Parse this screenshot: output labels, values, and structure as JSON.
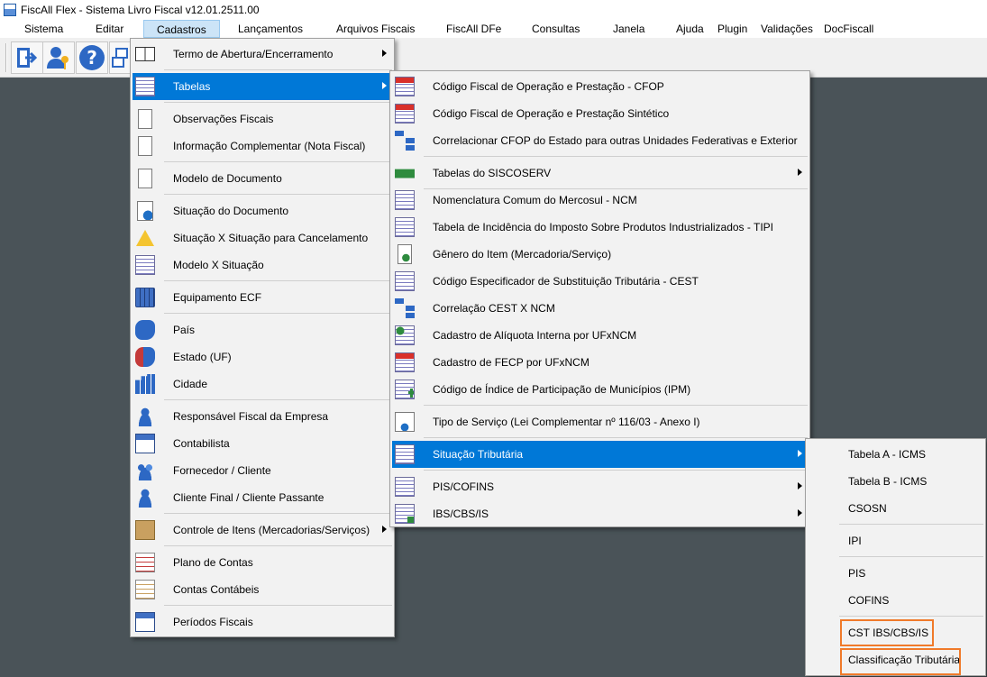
{
  "window": {
    "title": "FiscAll Flex - Sistema Livro Fiscal v12.01.2511.00"
  },
  "menubar": {
    "items": [
      "Sistema",
      "Editar",
      "Cadastros",
      "Lançamentos",
      "Arquivos Fiscais",
      "FiscAll DFe",
      "Consultas",
      "Janela",
      "Ajuda",
      "Plugin",
      "Validações",
      "DocFiscall"
    ],
    "active": "Cadastros"
  },
  "toolbar": {
    "icons": [
      "exit-icon",
      "user-key-icon",
      "help-icon",
      "window-icon"
    ]
  },
  "cadastros_menu": {
    "items": [
      {
        "label": "Termo de Abertura/Encerramento",
        "icon": "book-icon",
        "submenu": true
      },
      {
        "label": "Tabelas",
        "icon": "table-icon",
        "submenu": true,
        "highlighted": true
      },
      {
        "label": "Observações Fiscais",
        "icon": "document-pen-icon"
      },
      {
        "label": "Informação Complementar (Nota Fiscal)",
        "icon": "document-add-icon"
      },
      {
        "label": "Modelo de Documento",
        "icon": "document-icon"
      },
      {
        "label": "Situação do Documento",
        "icon": "document-info-icon"
      },
      {
        "label": "Situação X Situação para Cancelamento",
        "icon": "warning-icon"
      },
      {
        "label": "Modelo X Situação",
        "icon": "table-icon"
      },
      {
        "label": "Equipamento ECF",
        "icon": "calculator-icon"
      },
      {
        "label": "País",
        "icon": "map-icon"
      },
      {
        "label": "Estado (UF)",
        "icon": "map-state-icon"
      },
      {
        "label": "Cidade",
        "icon": "city-icon"
      },
      {
        "label": "Responsável Fiscal da Empresa",
        "icon": "user-icon"
      },
      {
        "label": "Contabilista",
        "icon": "accountant-icon"
      },
      {
        "label": "Fornecedor / Cliente",
        "icon": "users-icon"
      },
      {
        "label": "Cliente Final / Cliente Passante",
        "icon": "user-icon"
      },
      {
        "label": "Controle de Itens (Mercadorias/Serviços)",
        "icon": "box-icon",
        "submenu": true
      },
      {
        "label": "Plano de Contas",
        "icon": "sheet-icon"
      },
      {
        "label": "Contas Contábeis",
        "icon": "ledger-icon"
      },
      {
        "label": "Períodos Fiscais",
        "icon": "calendar-icon"
      }
    ]
  },
  "tabelas_menu": {
    "items": [
      {
        "label": "Código Fiscal de Operação e Prestação - CFOP",
        "icon": "table-cfop-icon"
      },
      {
        "label": "Código Fiscal de Operação e Prestação Sintético",
        "icon": "table-red-icon"
      },
      {
        "label": "Correlacionar CFOP do Estado para outras Unidades Federativas e Exterior",
        "icon": "tree-icon"
      },
      {
        "label": "Tabelas do SISCOSERV",
        "icon": "brazil-flag-icon",
        "submenu": true
      },
      {
        "label": "Nomenclatura Comum do Mercosul  - NCM",
        "icon": "table-ncm-icon"
      },
      {
        "label": "Tabela de Incidência do Imposto Sobre Produtos Industrializados - TIPI",
        "icon": "table-tipi-icon"
      },
      {
        "label": "Gênero do Item (Mercadoria/Serviço)",
        "icon": "money-icon"
      },
      {
        "label": "Código Especificador de Substituição Tributária - CEST",
        "icon": "table-cest-icon"
      },
      {
        "label": "Correlação CEST X NCM",
        "icon": "tree-icon"
      },
      {
        "label": "Cadastro de Alíquota Interna por UFxNCM",
        "icon": "table-green-icon"
      },
      {
        "label": "Cadastro de FECP por UFxNCM",
        "icon": "table-fecp-icon"
      },
      {
        "label": "Código de Índice de Participação de Municípios (IPM)",
        "icon": "table-add-icon"
      },
      {
        "label": "Tipo de Serviço (Lei Complementar nº 116/03 - Anexo I)",
        "icon": "service-icon"
      },
      {
        "label": "Situação Tributária",
        "icon": "table-icon",
        "submenu": true,
        "highlighted": true
      },
      {
        "label": "PIS/COFINS",
        "icon": "table-icon",
        "submenu": true
      },
      {
        "label": "IBS/CBS/IS",
        "icon": "table-percent-icon",
        "submenu": true
      }
    ]
  },
  "situacao_menu": {
    "items": [
      {
        "label": "Tabela A - ICMS"
      },
      {
        "label": "Tabela B - ICMS"
      },
      {
        "label": "CSOSN"
      },
      {
        "label": "IPI"
      },
      {
        "label": "PIS"
      },
      {
        "label": "COFINS"
      },
      {
        "label": "CST IBS/CBS/IS",
        "boxed": true
      },
      {
        "label": "Classificação Tributária",
        "boxed": true
      }
    ]
  },
  "colors": {
    "highlight": "#0078d7",
    "annotation_box": "#f07a2a",
    "desktop": "#4a5358"
  }
}
